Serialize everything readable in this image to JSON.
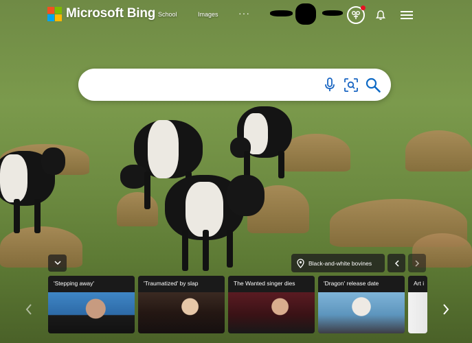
{
  "header": {
    "brand": "Microsoft Bing",
    "nav": [
      "School",
      "Images"
    ],
    "more": "···"
  },
  "search": {
    "value": "",
    "placeholder": ""
  },
  "image_info": {
    "caption": "Black-and-white bovines"
  },
  "news": [
    {
      "title": "'Stepping away'"
    },
    {
      "title": "'Traumatized' by slap"
    },
    {
      "title": "The Wanted singer dies"
    },
    {
      "title": "'Dragon' release date"
    },
    {
      "title": "Art i"
    }
  ],
  "colors": {
    "ms_red": "#f25022",
    "ms_green": "#7fba00",
    "ms_blue": "#00a4ef",
    "ms_yellow": "#ffb900",
    "notification_dot": "#e81123",
    "search_icon": "#0c69c5"
  }
}
